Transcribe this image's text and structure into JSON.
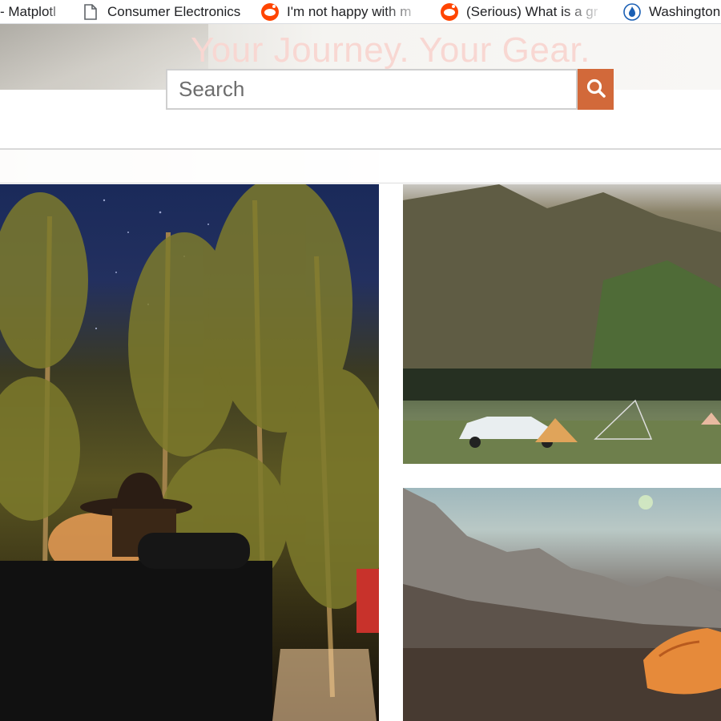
{
  "bookmarks": [
    {
      "label": "- Matplotl",
      "icon": "none"
    },
    {
      "label": "Consumer Electronics",
      "icon": "page-icon"
    },
    {
      "label": "I'm not happy with m",
      "icon": "reddit-icon"
    },
    {
      "label": "(Serious) What is a gr",
      "icon": "reddit-icon"
    },
    {
      "label": "Washington",
      "icon": "shield-flame-icon"
    }
  ],
  "header": {
    "tagline": "Your Journey. Your Gear."
  },
  "search": {
    "placeholder": "Search",
    "button_icon": "search-icon"
  },
  "colors": {
    "accent": "#d2693a",
    "tagline": "#f8d7d2",
    "reddit": "#ff4500"
  }
}
